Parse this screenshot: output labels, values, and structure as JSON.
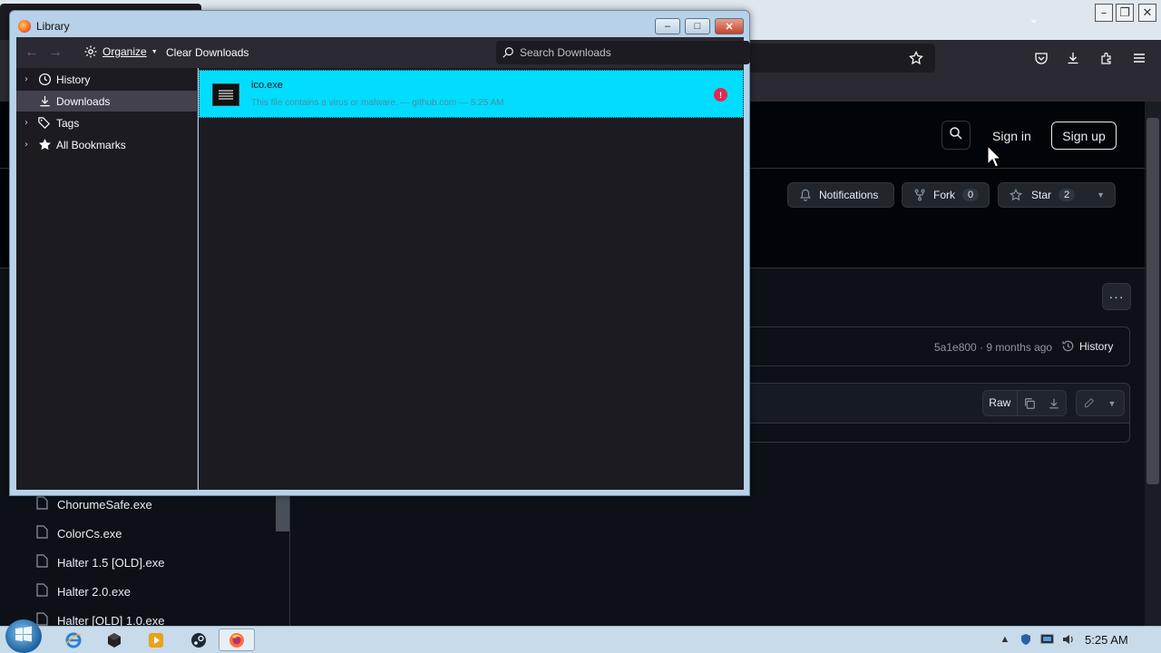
{
  "library": {
    "title": "Library",
    "toolbar": {
      "back": "←",
      "forward": "→",
      "organize_label": "Organize",
      "clear_downloads_label": "Clear Downloads",
      "search_placeholder": "Search Downloads"
    },
    "sidebar": {
      "items": [
        {
          "label": "History",
          "icon": "clock-icon",
          "expandable": true,
          "selected": false
        },
        {
          "label": "Downloads",
          "icon": "download-icon",
          "expandable": false,
          "selected": true
        },
        {
          "label": "Tags",
          "icon": "tag-icon",
          "expandable": true,
          "selected": false
        },
        {
          "label": "All Bookmarks",
          "icon": "star-icon",
          "expandable": true,
          "selected": false
        }
      ]
    },
    "downloads": [
      {
        "filename": "ico.exe",
        "status": "This file contains a virus or malware. — github.com — 5:25 AM",
        "alert_icon": "warning-icon",
        "highlight_color": "#00ddff"
      }
    ],
    "window_controls": {
      "minimize": "–",
      "maximize": "□",
      "close": "✕"
    }
  },
  "github": {
    "header": {
      "signin_label": "Sign in",
      "signup_label": "Sign up"
    },
    "repo_actions": {
      "notifications_label": "Notifications",
      "fork_label": "Fork",
      "fork_count": "0",
      "star_label": "Star",
      "star_count": "2"
    },
    "more_label": "···",
    "commit": {
      "meta": "5a1e800 · 9 months ago",
      "history_label": "History"
    },
    "file_toolbar": {
      "raw_label": "Raw"
    },
    "file_list": [
      "ChorumeSafe.exe",
      "ColorCs.exe",
      "Halter 1.5 [OLD].exe",
      "Halter 2.0.exe",
      "Halter [OLD] 1.0.exe"
    ]
  },
  "taskbar": {
    "clock": "5:25 AM"
  },
  "colors": {
    "accent_download_row": "#00ddff",
    "alert": "#e22850",
    "github_bg": "#0d1117",
    "firefox_toolbar": "#2b2a33"
  }
}
